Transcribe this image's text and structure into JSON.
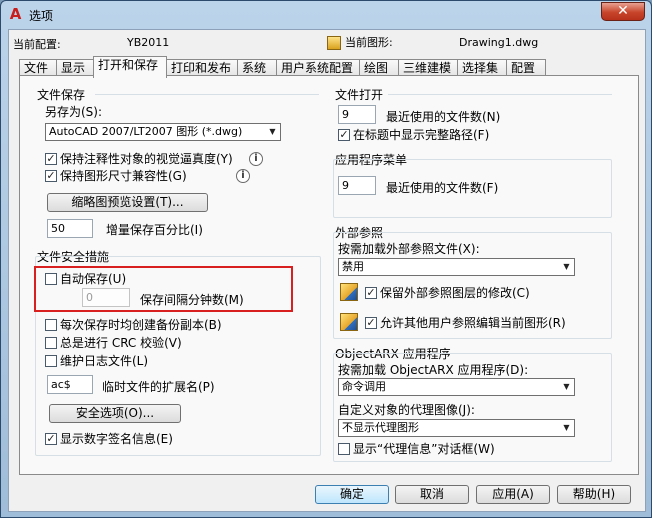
{
  "window": {
    "title": "选项",
    "app_icon": "autocad-a-icon",
    "close_glyph": "✕"
  },
  "header": {
    "current_profile_label": "当前配置:",
    "current_profile_value": "YB2011",
    "current_drawing_label": "当前图形:",
    "current_drawing_value": "Drawing1.dwg"
  },
  "tabs": [
    {
      "label": "文件",
      "active": false
    },
    {
      "label": "显示",
      "active": false
    },
    {
      "label": "打开和保存",
      "active": true
    },
    {
      "label": "打印和发布",
      "active": false
    },
    {
      "label": "系统",
      "active": false
    },
    {
      "label": "用户系统配置",
      "active": false
    },
    {
      "label": "绘图",
      "active": false
    },
    {
      "label": "三维建模",
      "active": false
    },
    {
      "label": "选择集",
      "active": false
    },
    {
      "label": "配置",
      "active": false
    }
  ],
  "file_save": {
    "title": "文件保存",
    "save_as_label": "另存为(S):",
    "save_as_value": "AutoCAD 2007/LT2007 图形 (*.dwg)",
    "maintain_annotative_label": "保持注释性对象的视觉逼真度(Y)",
    "maintain_annotative_checked": true,
    "maintain_drawing_size_label": "保持图形尺寸兼容性(G)",
    "maintain_drawing_size_checked": true,
    "thumbnail_button": "缩略图预览设置(T)...",
    "incremental_value": "50",
    "incremental_label": "增量保存百分比(I)"
  },
  "file_safety": {
    "title": "文件安全措施",
    "autosave_label": "自动保存(U)",
    "autosave_checked": false,
    "minutes_value": "0",
    "minutes_label": "保存间隔分钟数(M)",
    "backup_label": "每次保存时均创建备份副本(B)",
    "backup_checked": false,
    "crc_label": "总是进行 CRC 校验(V)",
    "crc_checked": false,
    "log_label": "维护日志文件(L)",
    "log_checked": false,
    "temp_ext_value": "ac$",
    "temp_ext_label": "临时文件的扩展名(P)",
    "security_button": "安全选项(O)...",
    "digital_sig_label": "显示数字签名信息(E)",
    "digital_sig_checked": true
  },
  "file_open": {
    "title": "文件打开",
    "recent_value": "9",
    "recent_label": "最近使用的文件数(N)",
    "full_path_label": "在标题中显示完整路径(F)",
    "full_path_checked": true
  },
  "app_menu": {
    "title": "应用程序菜单",
    "recent_value": "9",
    "recent_label": "最近使用的文件数(F)"
  },
  "xref": {
    "title": "外部参照",
    "demand_load_label": "按需加载外部参照文件(X):",
    "demand_load_value": "禁用",
    "retain_layer_label": "保留外部参照图层的修改(C)",
    "retain_layer_checked": true,
    "allow_edit_label": "允许其他用户参照编辑当前图形(R)",
    "allow_edit_checked": true
  },
  "objectarx": {
    "title": "ObjectARX 应用程序",
    "demand_load_label": "按需加载 ObjectARX 应用程序(D):",
    "demand_load_value": "命令调用",
    "proxy_label": "自定义对象的代理图像(J):",
    "proxy_value": "不显示代理图形",
    "proxy_info_label": "显示“代理信息”对话框(W)",
    "proxy_info_checked": false
  },
  "buttons": {
    "ok": "确定",
    "cancel": "取消",
    "apply": "应用(A)",
    "help": "帮助(H)"
  },
  "colors": {
    "highlight": "#d82020",
    "accent": "#3c7fb1"
  }
}
